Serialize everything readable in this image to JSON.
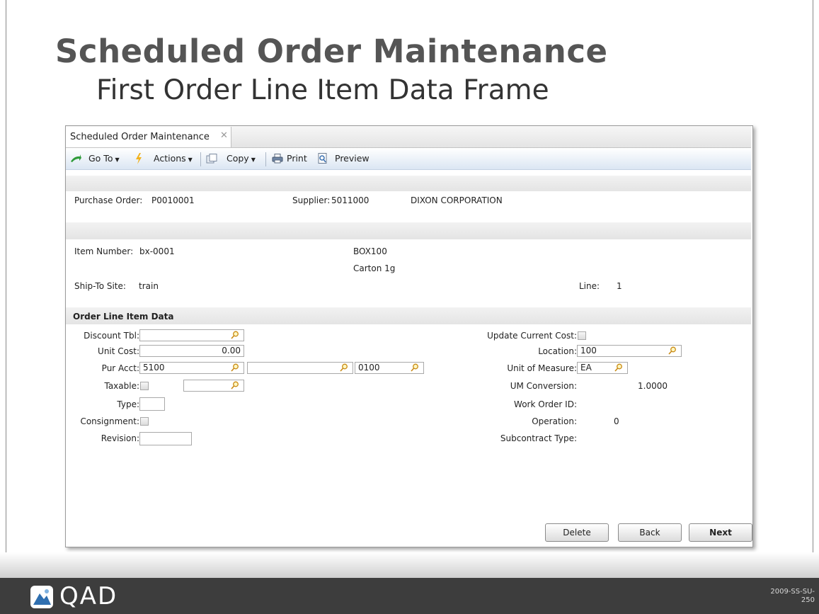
{
  "slide": {
    "title": "Scheduled Order Maintenance",
    "subtitle": "First Order Line Item Data Frame",
    "logo_text": "QAD",
    "code_line1": "2009-SS-SU-",
    "code_line2": "250"
  },
  "window": {
    "tab_label": "Scheduled Order Maintenance",
    "close_glyph": "✕"
  },
  "toolbar": {
    "goto": "Go To",
    "actions": "Actions",
    "copy": "Copy",
    "print": "Print",
    "preview": "Preview",
    "dropdown_glyph": "▼"
  },
  "header": {
    "po_label": "Purchase Order:",
    "po_value": "P0010001",
    "supplier_label": "Supplier:",
    "supplier_value": "5011000",
    "supplier_name": "DIXON CORPORATION"
  },
  "item": {
    "item_label": "Item Number:",
    "item_value": "bx-0001",
    "desc1": "BOX100",
    "desc2": "Carton 1g",
    "site_label": "Ship-To Site:",
    "site_value": "train",
    "line_label": "Line:",
    "line_value": "1"
  },
  "section": {
    "title": "Order Line Item Data"
  },
  "form_left": {
    "discount_label": "Discount Tbl:",
    "discount_value": "",
    "unit_cost_label": "Unit Cost:",
    "unit_cost_value": "0.00",
    "pur_acct_label": "Pur Acct:",
    "pur_acct_value": "5100",
    "pur_acct_sub": "",
    "pur_acct_cc": "0100",
    "taxable_label": "Taxable:",
    "taxable_code": "",
    "type_label": "Type:",
    "type_value": "",
    "consignment_label": "Consignment:",
    "revision_label": "Revision:",
    "revision_value": ""
  },
  "form_right": {
    "update_cost_label": "Update Current Cost:",
    "location_label": "Location:",
    "location_value": "100",
    "um_label": "Unit of Measure:",
    "um_value": "EA",
    "um_conv_label": "UM Conversion:",
    "um_conv_value": "1.0000",
    "wo_label": "Work Order ID:",
    "wo_value": "",
    "operation_label": "Operation:",
    "operation_value": "0",
    "subcontract_label": "Subcontract Type:",
    "subcontract_value": ""
  },
  "buttons": {
    "delete": "Delete",
    "back": "Back",
    "next": "Next"
  }
}
